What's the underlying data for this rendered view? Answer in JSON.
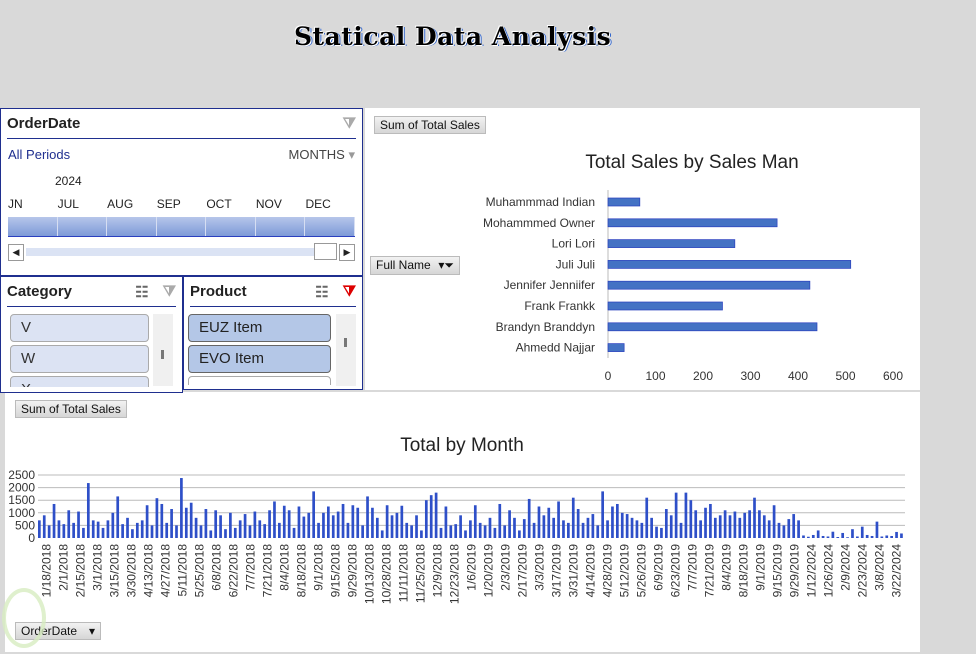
{
  "page_title": "Statical Data Analysis",
  "timeline": {
    "title": "OrderDate",
    "all_periods": "All Periods",
    "level": "MONTHS",
    "year": "2024",
    "months": [
      "JN",
      "JUL",
      "AUG",
      "SEP",
      "OCT",
      "NOV",
      "DEC"
    ]
  },
  "category": {
    "title": "Category",
    "items": [
      "V",
      "W",
      "X"
    ]
  },
  "product": {
    "title": "Product",
    "items": [
      "EUZ Item",
      "EVO Item",
      ""
    ]
  },
  "top_chart": {
    "field_button": "Sum of Total Sales",
    "axis_button": "Full Name"
  },
  "bottom_chart": {
    "field_button": "Sum of Total Sales",
    "axis_button": "OrderDate"
  },
  "colors": {
    "bar": "#4472c4",
    "bar_dark": "#2a3fbf",
    "accent": "#1f2f8f"
  },
  "chart_data": [
    {
      "type": "bar",
      "orientation": "horizontal",
      "title": "Total Sales by Sales Man",
      "categories": [
        "Muhammmad Indian",
        "Mohammmed Owner",
        "Lori Lori",
        "Juli Juli",
        "Jennifer Jenniifer",
        "Frank Frankk",
        "Brandyn Branddyn",
        "Ahmedd Najjar"
      ],
      "values": [
        67,
        356,
        267,
        511,
        425,
        241,
        440,
        34
      ],
      "xlim": [
        0,
        600
      ],
      "xticks": [
        0,
        100,
        200,
        300,
        400,
        500,
        600
      ],
      "grid": false,
      "legend": "none"
    },
    {
      "type": "bar",
      "title": "Total by Month",
      "ylim": [
        0,
        2500
      ],
      "yticks": [
        0,
        500,
        1000,
        1500,
        2000,
        2500
      ],
      "grid": true,
      "legend": "none",
      "xtick_labels": [
        "1/18/2018",
        "2/1/2018",
        "2/15/2018",
        "3/1/2018",
        "3/15/2018",
        "3/30/2018",
        "4/13/2018",
        "4/27/2018",
        "5/11/2018",
        "5/25/2018",
        "6/8/2018",
        "6/22/2018",
        "7/7/2018",
        "7/21/2018",
        "8/4/2018",
        "8/18/2018",
        "9/1/2018",
        "9/15/2018",
        "9/29/2018",
        "10/13/2018",
        "10/28/2018",
        "11/11/2018",
        "11/25/2018",
        "12/9/2018",
        "12/23/2018",
        "1/6/2019",
        "1/20/2019",
        "2/3/2019",
        "2/17/2019",
        "3/3/2019",
        "3/17/2019",
        "3/31/2019",
        "4/14/2019",
        "4/28/2019",
        "5/12/2019",
        "5/26/2019",
        "6/9/2019",
        "6/23/2019",
        "7/7/2019",
        "7/21/2019",
        "8/4/2019",
        "8/18/2019",
        "9/1/2019",
        "9/15/2019",
        "9/29/2019",
        "1/12/2024",
        "1/26/2024",
        "2/9/2024",
        "2/23/2024",
        "3/8/2024",
        "3/22/2024"
      ],
      "values": [
        700,
        900,
        500,
        1350,
        700,
        550,
        1100,
        600,
        1050,
        400,
        2180,
        700,
        650,
        400,
        700,
        1000,
        1650,
        550,
        800,
        350,
        600,
        700,
        1300,
        500,
        1580,
        1350,
        600,
        1150,
        500,
        2380,
        1200,
        1400,
        800,
        500,
        1150,
        300,
        1100,
        900,
        350,
        1000,
        400,
        700,
        950,
        500,
        1050,
        700,
        550,
        1100,
        1450,
        600,
        1280,
        1100,
        400,
        1250,
        850,
        1000,
        1850,
        600,
        1000,
        1250,
        900,
        1050,
        1350,
        600,
        1300,
        1200,
        500,
        1650,
        1200,
        800,
        300,
        1300,
        900,
        1000,
        1280,
        600,
        500,
        900,
        300,
        1500,
        1700,
        1800,
        400,
        1250,
        500,
        550,
        900,
        300,
        700,
        1300,
        600,
        500,
        800,
        400,
        1350,
        500,
        1100,
        800,
        300,
        750,
        1550,
        600,
        1250,
        900,
        1200,
        800,
        1450,
        700,
        600,
        1600,
        1150,
        600,
        800,
        950,
        500,
        1850,
        700,
        1250,
        1350,
        1000,
        950,
        800,
        700,
        600,
        1600,
        800,
        450,
        400,
        1150,
        900,
        1800,
        600,
        1800,
        1500,
        1100,
        700,
        1200,
        1350,
        800,
        900,
        1100,
        900,
        1050,
        800,
        1000,
        1100,
        1600,
        1100,
        900,
        700,
        1300,
        600,
        500,
        750,
        950,
        700,
        100,
        50,
        120,
        300,
        80,
        60,
        250,
        40,
        200,
        30,
        350,
        60,
        450,
        120,
        80,
        650,
        60,
        100,
        80,
        240,
        180
      ]
    }
  ]
}
